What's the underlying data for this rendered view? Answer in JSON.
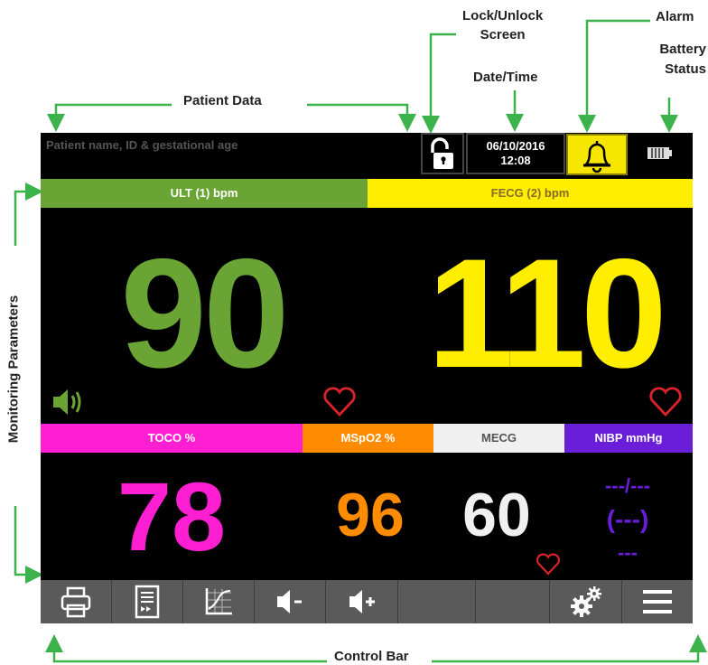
{
  "callouts": {
    "patient_data": "Patient Data",
    "lock_unlock_1": "Lock/Unlock",
    "lock_unlock_2": "Screen",
    "date_time": "Date/Time",
    "alarm": "Alarm",
    "battery_1": "Battery",
    "battery_2": "Status",
    "monitoring": "Monitoring Parameters",
    "control_bar": "Control Bar"
  },
  "topbar": {
    "patient_placeholder": "Patient name, ID & gestational age",
    "date": "06/10/2016",
    "time": "12:08",
    "lock_icon": "unlocked-padlock-icon",
    "alarm_icon": "bell-icon",
    "battery_icon": "battery-full-icon"
  },
  "channels": {
    "ult": {
      "label": "ULT (1) bpm",
      "value": "90",
      "color": "#6aa434"
    },
    "fecg": {
      "label": "FECG (2) bpm",
      "value": "110",
      "color": "#ffee00"
    },
    "toco": {
      "label": "TOCO %",
      "value": "78",
      "color": "#ff1fd3"
    },
    "mspo2": {
      "label": "MSpO2 %",
      "value": "96",
      "color": "#ff8c00"
    },
    "mecg": {
      "label": "MECG",
      "value": "60",
      "color": "#f0f0f0"
    },
    "nibp": {
      "label": "NIBP mmHg",
      "line1": "---/---",
      "line2": "(---)",
      "line3": "---",
      "color": "#6a1ed8"
    }
  },
  "colors": {
    "heart": "#d9232a",
    "speaker": "#6aa434",
    "control_bar": "#5a5a5a"
  },
  "control_bar": {
    "buttons": [
      "print-icon",
      "report-icon",
      "trend-graph-icon",
      "volume-down-icon",
      "volume-up-icon",
      "empty",
      "empty",
      "settings-gears-icon",
      "menu-icon"
    ]
  }
}
